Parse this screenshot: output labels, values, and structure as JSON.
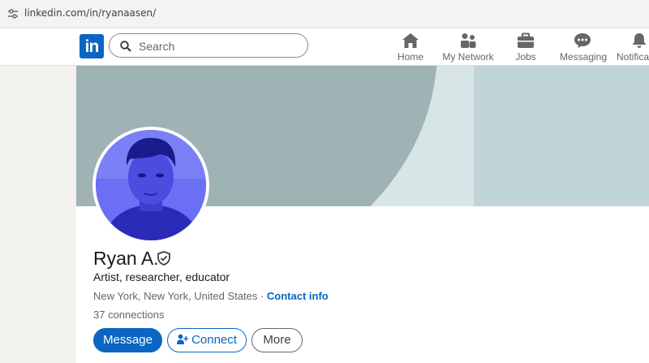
{
  "browser": {
    "url": "linkedin.com/in/ryanaasen/"
  },
  "nav": {
    "logo_text": "in",
    "search_placeholder": "Search",
    "items": [
      {
        "label": "Home",
        "icon": "home-icon"
      },
      {
        "label": "My Network",
        "icon": "my-network-icon"
      },
      {
        "label": "Jobs",
        "icon": "briefcase-icon"
      },
      {
        "label": "Messaging",
        "icon": "messaging-icon"
      },
      {
        "label": "Notifications",
        "icon": "bell-icon"
      }
    ]
  },
  "profile": {
    "name": "Ryan A.",
    "headline": "Artist, researcher, educator",
    "location": "New York, New York, United States",
    "location_separator": " · ",
    "contact_info": "Contact info",
    "connections": "37 connections",
    "buttons": {
      "message": "Message",
      "connect": "Connect",
      "more": "More"
    }
  },
  "colors": {
    "brand_blue": "#0a66c2",
    "banner_dark": "#9fb2b4",
    "banner_light": "#c1d4d8",
    "avatar_tint": "#5a5df0"
  }
}
